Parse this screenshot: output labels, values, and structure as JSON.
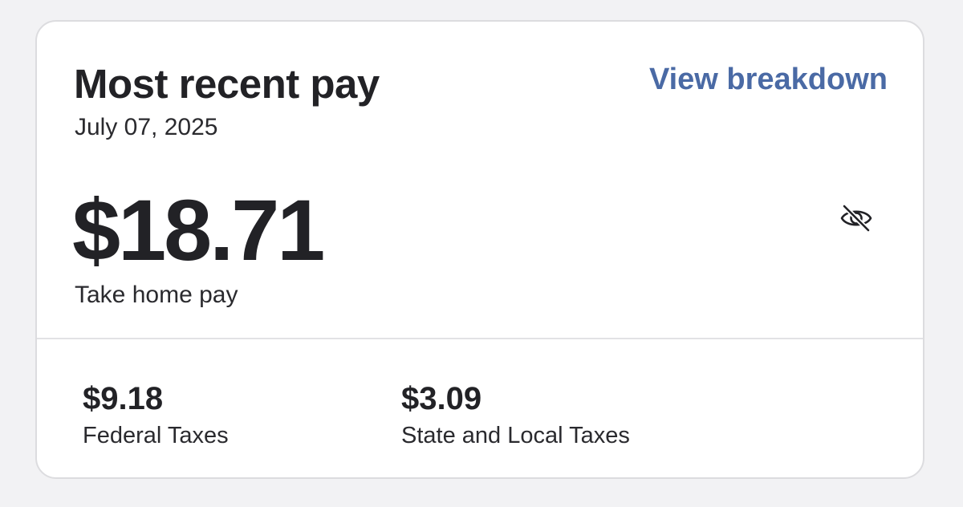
{
  "header": {
    "title": "Most recent pay",
    "date": "July 07, 2025",
    "breakdown_link": "View breakdown"
  },
  "pay": {
    "amount": "$18.71",
    "label": "Take home pay",
    "visibility_icon": "eye-slash-icon"
  },
  "taxes": [
    {
      "amount": "$9.18",
      "label": "Federal Taxes"
    },
    {
      "amount": "$3.09",
      "label": "State and Local Taxes"
    }
  ],
  "colors": {
    "link": "#4a6aa5",
    "text": "#222226",
    "card_border": "#dcdcdf",
    "background": "#f2f2f4"
  }
}
